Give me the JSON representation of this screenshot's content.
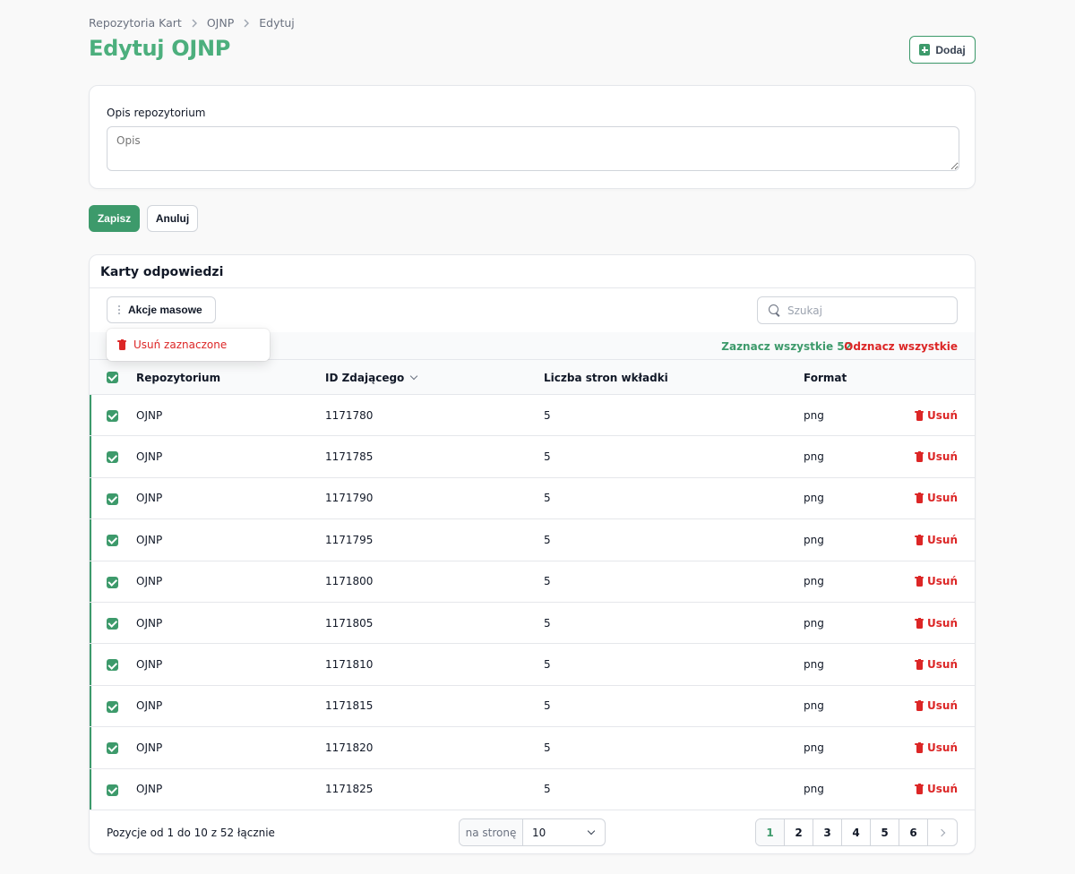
{
  "breadcrumb": [
    "Repozytoria Kart",
    "OJNP",
    "Edytuj"
  ],
  "page_title": "Edytuj OJNP",
  "add_button": "Dodaj",
  "description": {
    "label": "Opis repozytorium",
    "placeholder": "Opis",
    "value": ""
  },
  "form_actions": {
    "save": "Zapisz",
    "cancel": "Anuluj"
  },
  "table_card": {
    "title": "Karty odpowiedzi",
    "bulk_actions": "Akcje masowe",
    "bulk_menu_item": "Usuń zaznaczone",
    "search_placeholder": "Szukaj",
    "select_all": "Zaznacz wszystkie 52",
    "deselect_all": "Odznacz wszystkie",
    "columns": [
      "Repozytorium",
      "ID Zdającego",
      "Liczba stron wkładki",
      "Format"
    ],
    "delete_label": "Usuń",
    "rows": [
      {
        "repo": "OJNP",
        "id": "1171780",
        "pages": "5",
        "format": "png",
        "checked": true
      },
      {
        "repo": "OJNP",
        "id": "1171785",
        "pages": "5",
        "format": "png",
        "checked": true
      },
      {
        "repo": "OJNP",
        "id": "1171790",
        "pages": "5",
        "format": "png",
        "checked": true
      },
      {
        "repo": "OJNP",
        "id": "1171795",
        "pages": "5",
        "format": "png",
        "checked": true
      },
      {
        "repo": "OJNP",
        "id": "1171800",
        "pages": "5",
        "format": "png",
        "checked": true
      },
      {
        "repo": "OJNP",
        "id": "1171805",
        "pages": "5",
        "format": "png",
        "checked": true
      },
      {
        "repo": "OJNP",
        "id": "1171810",
        "pages": "5",
        "format": "png",
        "checked": true
      },
      {
        "repo": "OJNP",
        "id": "1171815",
        "pages": "5",
        "format": "png",
        "checked": true
      },
      {
        "repo": "OJNP",
        "id": "1171820",
        "pages": "5",
        "format": "png",
        "checked": true
      },
      {
        "repo": "OJNP",
        "id": "1171825",
        "pages": "5",
        "format": "png",
        "checked": true
      }
    ]
  },
  "footer": {
    "summary": "Pozycje od 1 do 10 z 52 łącznie",
    "per_page_label": "na stronę",
    "per_page_value": "10",
    "pages": [
      "1",
      "2",
      "3",
      "4",
      "5",
      "6"
    ],
    "current_page": "1"
  },
  "colors": {
    "accent": "#3d9a6b",
    "title": "#4caf7d",
    "danger": "#dc2626"
  }
}
